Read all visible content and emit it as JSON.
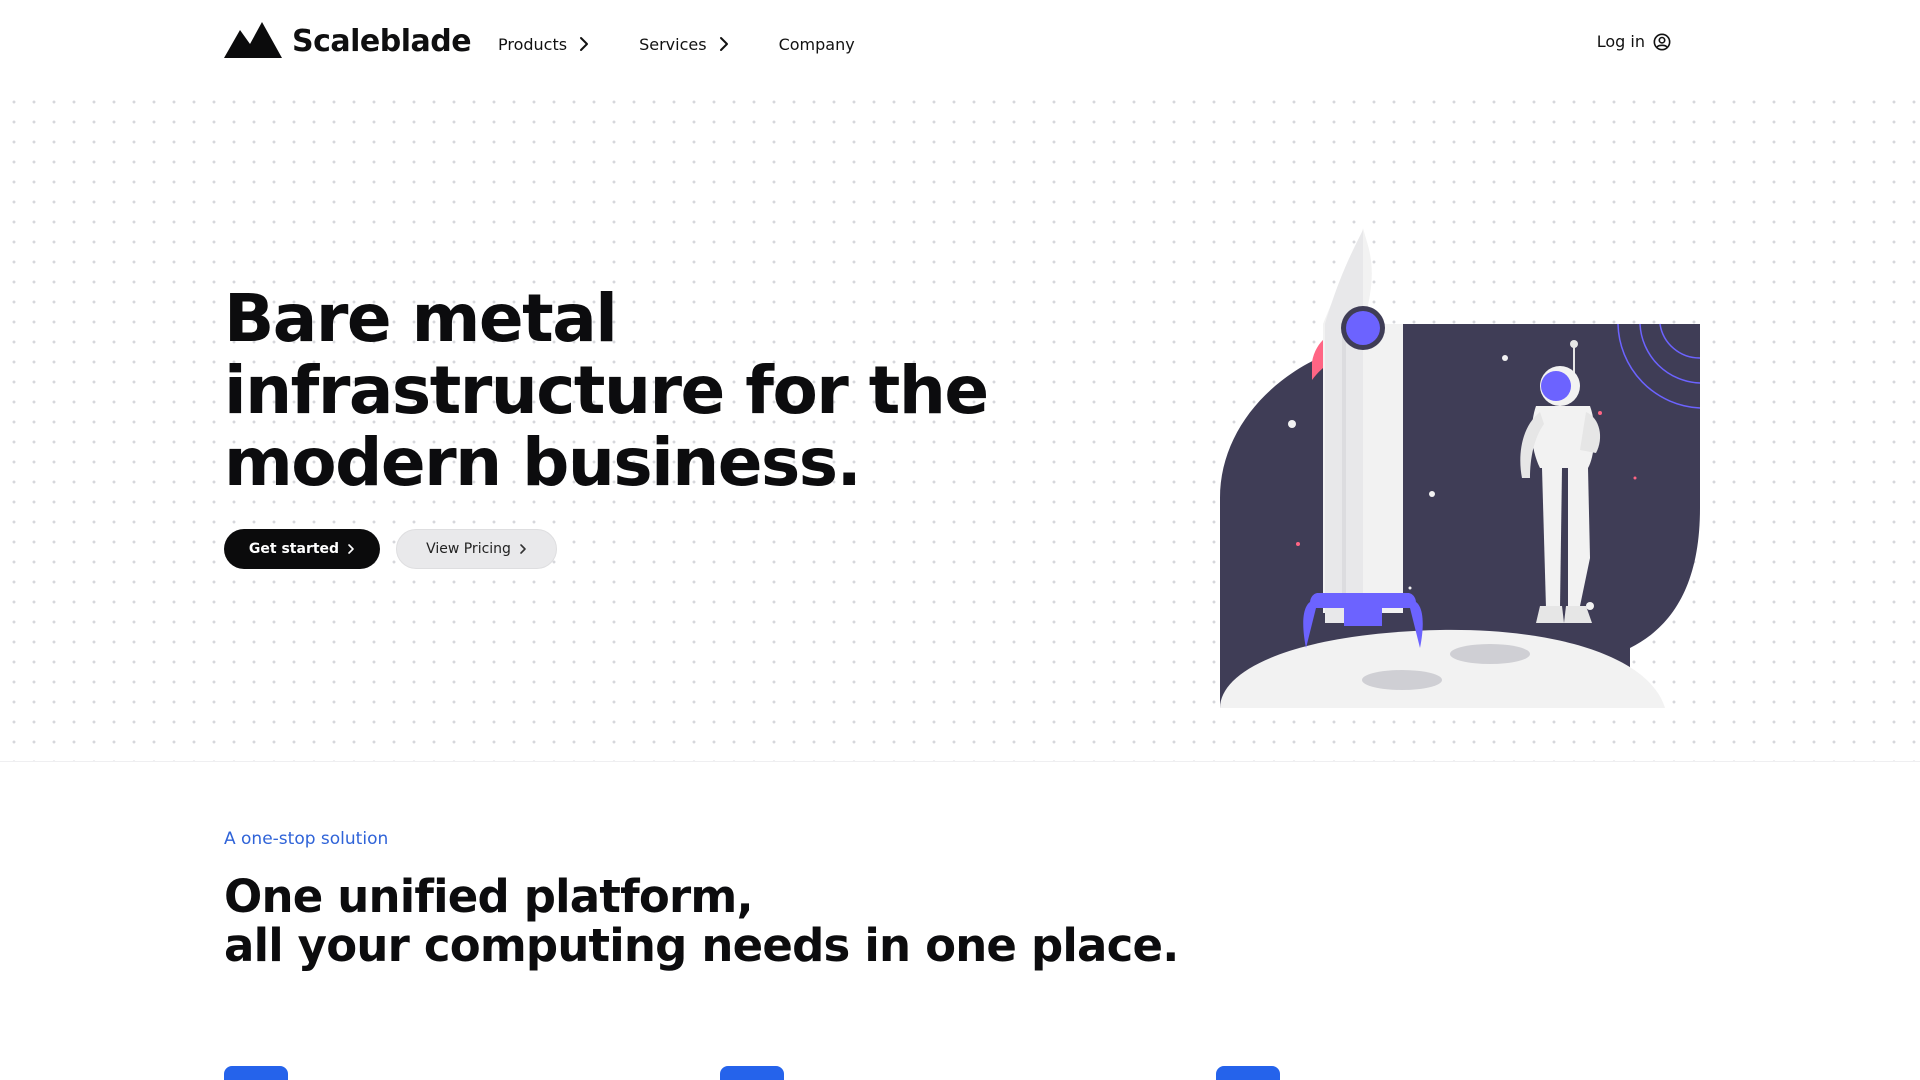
{
  "brand": {
    "name": "Scaleblade",
    "logo_icon": "mountain-logo-icon"
  },
  "nav": {
    "items": [
      {
        "label": "Products",
        "icon": "chevron-right-icon"
      },
      {
        "label": "Services",
        "icon": "chevron-right-icon"
      },
      {
        "label": "Company"
      }
    ],
    "login": {
      "label": "Log in",
      "icon": "user-circle-icon"
    }
  },
  "hero": {
    "title_lines": [
      "Bare metal",
      "infrastructure for the",
      "modern business."
    ],
    "primary_button": "Get started",
    "secondary_button": "View Pricing",
    "illustration": "rocket-astronaut-illustration"
  },
  "solution": {
    "eyebrow": "A one-stop solution",
    "title_lines": [
      "One unified platform,",
      "all your computing needs in one place."
    ]
  },
  "colors": {
    "accent": "#2f63d8",
    "feature_icon": "#2563eb",
    "illustration_space": "#3f3d56",
    "illustration_purple": "#6c63ff",
    "illustration_pink": "#ff6584",
    "button_dark": "#0b0b0c"
  }
}
